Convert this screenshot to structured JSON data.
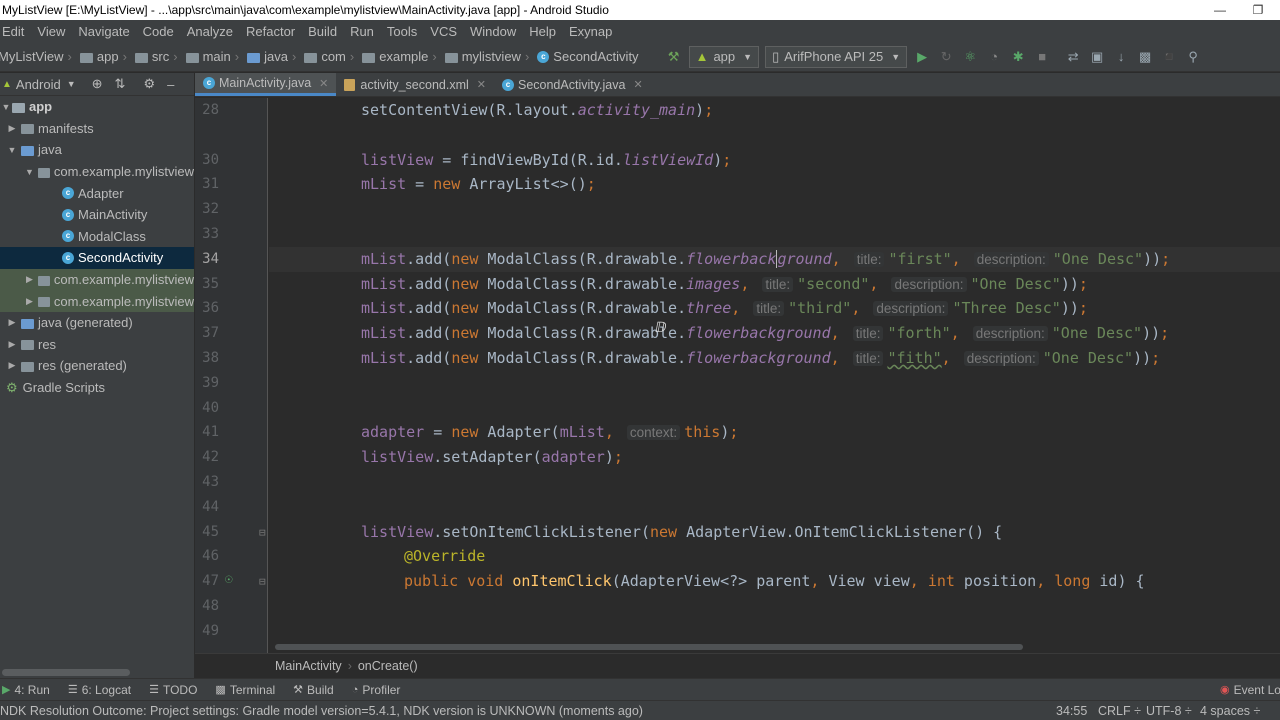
{
  "window": {
    "title": "MyListView [E:\\MyListView] - ...\\app\\src\\main\\java\\com\\example\\mylistview\\MainActivity.java [app] - Android Studio"
  },
  "menu": [
    "Edit",
    "View",
    "Navigate",
    "Code",
    "Analyze",
    "Refactor",
    "Build",
    "Run",
    "Tools",
    "VCS",
    "Window",
    "Help",
    "Exynap"
  ],
  "breadcrumbs": [
    "MyListView",
    "app",
    "src",
    "main",
    "java",
    "com",
    "example",
    "mylistview",
    "SecondActivity"
  ],
  "toolbar": {
    "run_config": "app",
    "device": "ArifPhone API 25"
  },
  "project_panel": {
    "view_mode": "Android",
    "tree": [
      {
        "label": "app",
        "level": 0,
        "type": "module",
        "expanded": true
      },
      {
        "label": "manifests",
        "level": 1,
        "type": "folder",
        "expanded": false
      },
      {
        "label": "java",
        "level": 1,
        "type": "folder",
        "expanded": true
      },
      {
        "label": "com.example.mylistview",
        "level": 2,
        "type": "package",
        "expanded": true
      },
      {
        "label": "Adapter",
        "level": 3,
        "type": "class"
      },
      {
        "label": "MainActivity",
        "level": 3,
        "type": "class"
      },
      {
        "label": "ModalClass",
        "level": 3,
        "type": "class"
      },
      {
        "label": "SecondActivity",
        "level": 3,
        "type": "class",
        "selected": true
      },
      {
        "label": "com.example.mylistview",
        "level": 2,
        "type": "package",
        "expanded": false,
        "test": true
      },
      {
        "label": "com.example.mylistview",
        "level": 2,
        "type": "package",
        "expanded": false,
        "test": true
      },
      {
        "label": "java (generated)",
        "level": 1,
        "type": "folder",
        "expanded": false
      },
      {
        "label": "res",
        "level": 1,
        "type": "folder",
        "expanded": false
      },
      {
        "label": "res (generated)",
        "level": 1,
        "type": "folder",
        "expanded": false
      },
      {
        "label": "Gradle Scripts",
        "level": 0,
        "type": "gradle",
        "expanded": false
      }
    ]
  },
  "tabs": [
    {
      "label": "MainActivity.java",
      "active": true
    },
    {
      "label": "activity_second.xml",
      "active": false
    },
    {
      "label": "SecondActivity.java",
      "active": false
    }
  ],
  "editor": {
    "line_numbers": [
      "28",
      "30",
      "31",
      "32",
      "33",
      "34",
      "35",
      "36",
      "37",
      "38",
      "39",
      "40",
      "41",
      "42",
      "43",
      "44",
      "45",
      "46",
      "47",
      "48",
      "49"
    ],
    "current_line": "34"
  },
  "editor_breadcrumb": [
    "MainActivity",
    "onCreate()"
  ],
  "tool_windows": [
    {
      "icon": "run-icon",
      "label": "4: Run"
    },
    {
      "icon": "logcat-icon",
      "label": "6: Logcat"
    },
    {
      "icon": "todo-icon",
      "label": "TODO"
    },
    {
      "icon": "terminal-icon",
      "label": "Terminal"
    },
    {
      "icon": "build-icon",
      "label": "Build"
    },
    {
      "icon": "profiler-icon",
      "label": "Profiler"
    }
  ],
  "event_log": "Event Log",
  "status": {
    "message": "NDK Resolution Outcome: Project settings: Gradle model version=5.4.1, NDK version is UNKNOWN (moments ago)",
    "position": "34:55",
    "line_sep": "CRLF ÷",
    "encoding": "UTF-8 ÷",
    "indent": "4 spaces ÷"
  },
  "colors": {
    "accent": "#4a88c7",
    "editor_bg": "#2b2b2b",
    "panel_bg": "#3c3f41",
    "keyword": "#cc7832",
    "string": "#6a8759"
  }
}
